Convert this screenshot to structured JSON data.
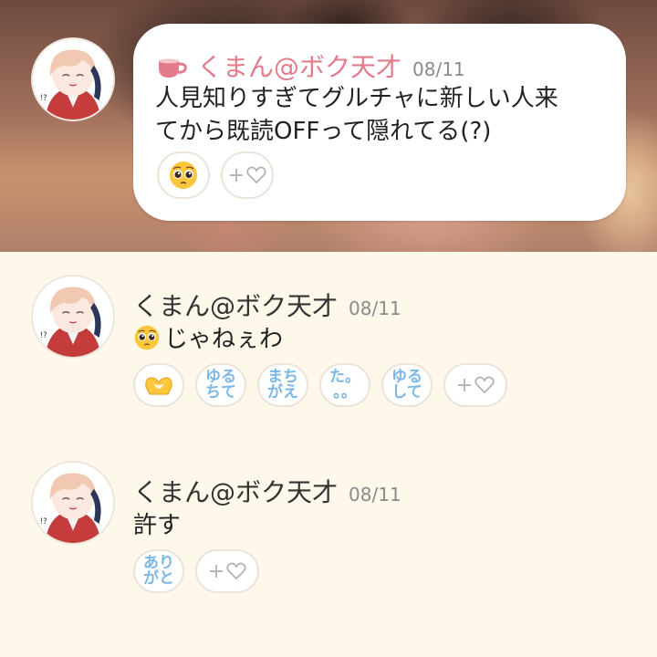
{
  "header_post": {
    "cup_icon": "teacup-icon",
    "username": "くまん@ボク天才",
    "date": "08/11",
    "text_line1": "人見知りすぎてグルチャに新しい人来",
    "text_line2": "てから既読OFFって隠れてる(?)",
    "reactions": [
      {
        "icon": "pleading-face-emoji"
      }
    ],
    "add_reaction_label": "+"
  },
  "messages": [
    {
      "username": "くまん@ボク天才",
      "date": "08/11",
      "text": "じゃねぇわ",
      "leading_emoji": "pleading-face-emoji",
      "stamps": [
        {
          "icon": "heart-hands-emoji"
        },
        {
          "label": "ゆる\nちて"
        },
        {
          "label": "まち\nがえ"
        },
        {
          "label": "た。\n。。"
        },
        {
          "label": "ゆる\nして"
        }
      ],
      "add_reaction_label": "+"
    },
    {
      "username": "くまん@ボク天才",
      "date": "08/11",
      "text": "許す",
      "stamps": [
        {
          "label": "あり\nがと"
        }
      ],
      "add_reaction_label": "+"
    }
  ],
  "colors": {
    "background": "#fdf8ea",
    "accent_pink": "#e27b8a",
    "stamp_blue": "#7cb8e5"
  }
}
